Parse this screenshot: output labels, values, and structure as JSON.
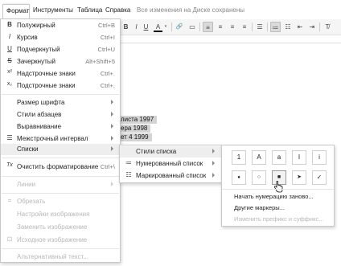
{
  "menubar": {
    "items": [
      "Формат",
      "Инструменты",
      "Таблица",
      "Справка"
    ],
    "status": "Все изменения на Диске сохранены"
  },
  "toolbar": {
    "buttons": [
      "B",
      "I",
      "U",
      "A",
      "🔗",
      "▤"
    ]
  },
  "document": {
    "lines": [
      "листа 1997",
      "ера  1998",
      "ет 4 1999"
    ]
  },
  "format_menu": {
    "items": [
      {
        "icon": "B",
        "label": "Полужирный",
        "shortcut": "Ctrl+B"
      },
      {
        "icon": "I",
        "label": "Курсив",
        "shortcut": "Ctrl+I"
      },
      {
        "icon": "U",
        "label": "Подчеркнутый",
        "shortcut": "Ctrl+U"
      },
      {
        "icon": "S",
        "label": "Зачеркнутый",
        "shortcut": "Alt+Shift+5"
      },
      {
        "icon": "x²",
        "label": "Надстрочные знаки",
        "shortcut": "Ctrl+."
      },
      {
        "icon": "x₂",
        "label": "Подстрочные знаки",
        "shortcut": "Ctrl+,"
      },
      {
        "label": "Размер шрифта"
      },
      {
        "label": "Стили абзацев"
      },
      {
        "label": "Выравнивание"
      },
      {
        "icon": "☰",
        "label": "Межстрочный интервал"
      },
      {
        "label": "Списки"
      },
      {
        "icon": "Tx",
        "label": "Очистить форматирование",
        "shortcut": "Ctrl+\\"
      },
      {
        "label": "Линии"
      },
      {
        "icon": "⌗",
        "label": "Обрезать"
      },
      {
        "label": "Настройки изображения"
      },
      {
        "label": "Заменить изображение"
      },
      {
        "icon": "⊡",
        "label": "Исходное изображение"
      },
      {
        "label": "Альтернативный текст..."
      }
    ]
  },
  "lists_menu": {
    "items": [
      {
        "label": "Стили списка"
      },
      {
        "icon": "≔",
        "label": "Нумерованный список"
      },
      {
        "icon": "☷",
        "label": "Маркированный список"
      }
    ]
  },
  "bullet_panel": {
    "row1": [
      "1",
      "A",
      "a",
      "I",
      "i"
    ],
    "row2": [
      "●",
      "○",
      "■",
      "➤",
      "✓"
    ],
    "actions": [
      "Начать нумерацию заново...",
      "Другие маркеры...",
      "Изменить префикс и суффикс..."
    ]
  }
}
